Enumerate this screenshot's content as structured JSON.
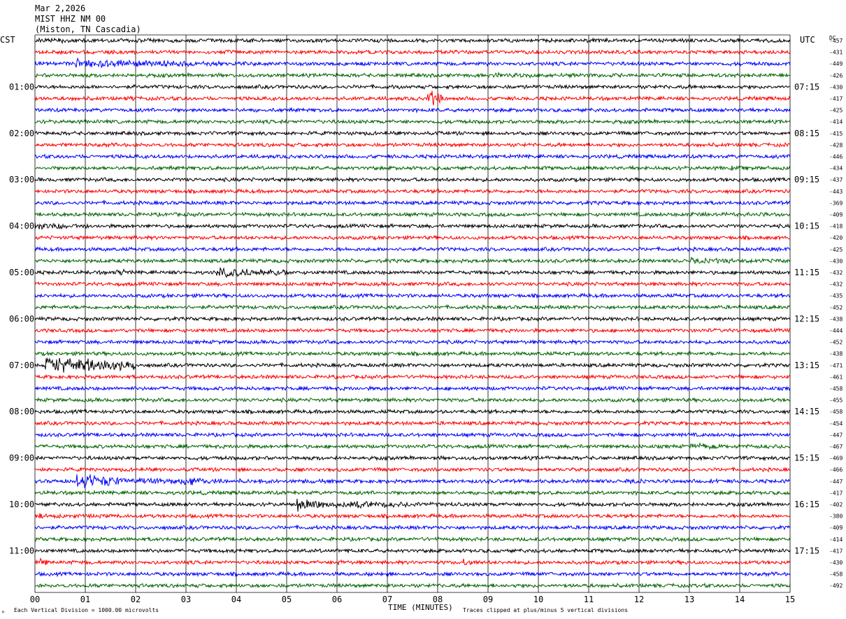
{
  "header": {
    "date": "Mar 2,2026",
    "station": "MIST HHZ NM 00",
    "location": "(Miston, TN Cascadia)"
  },
  "left_tz": "CST",
  "right_tz": "UTC",
  "dc_label": "DC",
  "left_hours": [
    "01:00",
    "02:00",
    "03:00",
    "04:00",
    "05:00",
    "06:00",
    "07:00",
    "08:00",
    "09:00",
    "10:00",
    "11:00"
  ],
  "right_hours": [
    "07:15",
    "08:15",
    "09:15",
    "10:15",
    "11:15",
    "12:15",
    "13:15",
    "14:15",
    "15:15",
    "16:15",
    "17:15"
  ],
  "x_ticks": [
    "00",
    "01",
    "02",
    "03",
    "04",
    "05",
    "06",
    "07",
    "08",
    "09",
    "10",
    "11",
    "12",
    "13",
    "14",
    "15"
  ],
  "xlabel": "TIME (MINUTES)",
  "footer_left": "Each Vertical Division = 1000.00 microvolts",
  "footer_right": "Traces clipped at plus/minus 5 vertical divisions",
  "corner_mark": "ᴹ",
  "trace_colors": [
    "#000000",
    "#ff0000",
    "#0000ff",
    "#006400"
  ],
  "chart_data": {
    "type": "line",
    "title": "MIST HHZ NM 00",
    "xlabel": "TIME (MINUTES)",
    "ylabel": "",
    "xlim": [
      0,
      15
    ],
    "traces_per_hour": 4,
    "minutes_per_trace": 15,
    "dc_offsets": [
      -457,
      -431,
      -449,
      -426,
      -430,
      -417,
      -425,
      -414,
      -415,
      -428,
      -446,
      -434,
      -437,
      -443,
      -369,
      -409,
      -418,
      -420,
      -425,
      -430,
      -432,
      -432,
      -435,
      -452,
      -438,
      -444,
      -452,
      -438,
      -471,
      -461,
      -458,
      -455,
      -458,
      -454,
      -447,
      -467,
      -469,
      -466,
      -447,
      -417,
      -402,
      -380,
      -409,
      -414,
      -417,
      -430,
      -458,
      -492
    ],
    "events": [
      {
        "trace": 0,
        "start_min": 0.0,
        "end_min": 4.5,
        "amplitude": 1.4
      },
      {
        "trace": 2,
        "start_min": 0.8,
        "end_min": 3.0,
        "amplitude": 2.5
      },
      {
        "trace": 2,
        "start_min": 3.0,
        "end_min": 5.0,
        "amplitude": 1.5
      },
      {
        "trace": 4,
        "start_min": 7.1,
        "end_min": 7.4,
        "amplitude": 1.5
      },
      {
        "trace": 5,
        "start_min": 7.8,
        "end_min": 8.1,
        "amplitude": 5.0
      },
      {
        "trace": 5,
        "start_min": 1.9,
        "end_min": 2.0,
        "amplitude": 2.0
      },
      {
        "trace": 16,
        "start_min": 0.0,
        "end_min": 1.2,
        "amplitude": 2.2
      },
      {
        "trace": 20,
        "start_min": 1.6,
        "end_min": 1.8,
        "amplitude": 2.5
      },
      {
        "trace": 20,
        "start_min": 3.6,
        "end_min": 5.0,
        "amplitude": 2.8
      },
      {
        "trace": 28,
        "start_min": 0.2,
        "end_min": 2.0,
        "amplitude": 5.0
      },
      {
        "trace": 37,
        "start_min": 10.5,
        "end_min": 11.0,
        "amplitude": 1.3
      },
      {
        "trace": 38,
        "start_min": 0.8,
        "end_min": 1.6,
        "amplitude": 5.0
      },
      {
        "trace": 38,
        "start_min": 1.6,
        "end_min": 6.0,
        "amplitude": 1.8
      },
      {
        "trace": 38,
        "start_min": 2.9,
        "end_min": 3.3,
        "amplitude": 3.0
      },
      {
        "trace": 38,
        "start_min": 11.8,
        "end_min": 12.2,
        "amplitude": 1.6
      },
      {
        "trace": 38,
        "start_min": 13.4,
        "end_min": 13.7,
        "amplitude": 1.6
      },
      {
        "trace": 40,
        "start_min": 5.2,
        "end_min": 8.5,
        "amplitude": 2.0
      },
      {
        "trace": 40,
        "start_min": 5.2,
        "end_min": 5.6,
        "amplitude": 3.5
      },
      {
        "trace": 40,
        "start_min": 6.4,
        "end_min": 6.7,
        "amplitude": 3.0
      },
      {
        "trace": 40,
        "start_min": 6.8,
        "end_min": 7.0,
        "amplitude": 2.5
      },
      {
        "trace": 41,
        "start_min": 0.0,
        "end_min": 2.0,
        "amplitude": 1.3
      },
      {
        "trace": 44,
        "start_min": 3.8,
        "end_min": 4.0,
        "amplitude": 1.5
      },
      {
        "trace": 44,
        "start_min": 6.0,
        "end_min": 6.3,
        "amplitude": 1.5
      },
      {
        "trace": 45,
        "start_min": 0.1,
        "end_min": 0.3,
        "amplitude": 2.0
      },
      {
        "trace": 45,
        "start_min": 6.0,
        "end_min": 6.2,
        "amplitude": 2.2
      },
      {
        "trace": 45,
        "start_min": 8.5,
        "end_min": 8.8,
        "amplitude": 2.2
      },
      {
        "trace": 46,
        "start_min": 6.6,
        "end_min": 6.9,
        "amplitude": 1.4
      },
      {
        "trace": 11,
        "start_min": 13.8,
        "end_min": 14.2,
        "amplitude": 1.3
      },
      {
        "trace": 15,
        "start_min": 13.0,
        "end_min": 15.0,
        "amplitude": 1.4
      },
      {
        "trace": 19,
        "start_min": 13.0,
        "end_min": 15.0,
        "amplitude": 1.6
      },
      {
        "trace": 35,
        "start_min": 13.0,
        "end_min": 15.0,
        "amplitude": 1.6
      },
      {
        "trace": 3,
        "start_min": 9.0,
        "end_min": 15.0,
        "amplitude": 1.3
      }
    ]
  }
}
